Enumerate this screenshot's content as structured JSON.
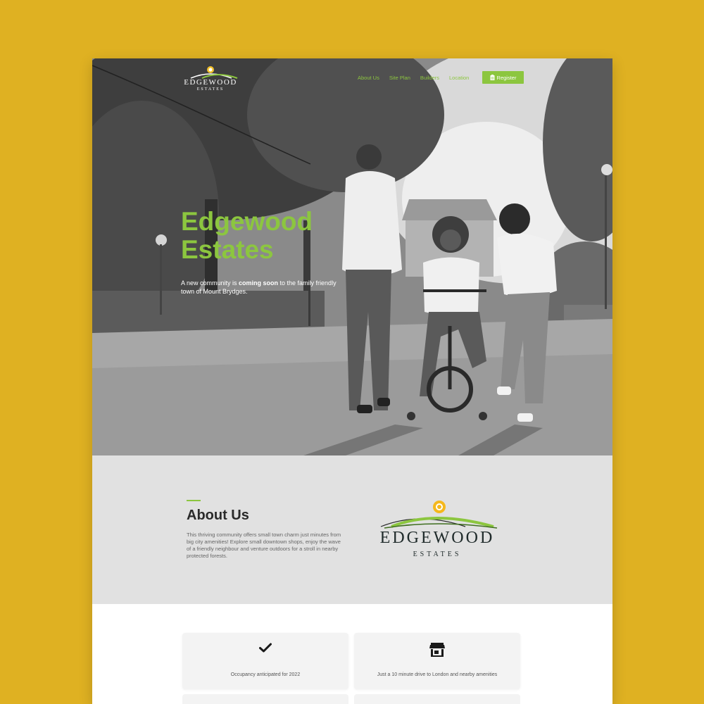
{
  "brand": {
    "name": "EDGEWOOD",
    "sub": "ESTATES"
  },
  "nav": {
    "items": [
      {
        "label": "About Us"
      },
      {
        "label": "Site Plan"
      },
      {
        "label": "Builders"
      },
      {
        "label": "Location"
      }
    ],
    "register_label": "Register"
  },
  "hero": {
    "title_line1": "Edgewood",
    "title_line2": "Estates",
    "sub_before": "A new community is ",
    "sub_bold": "coming soon",
    "sub_after": " to the family friendly town of Mount Brydges."
  },
  "about": {
    "heading": "About Us",
    "body": "This thriving community offers small town charm just minutes from big city amenities! Explore small downtown shops, enjoy the wave of a friendly neighbour and venture outdoors for a stroll in nearby protected forests."
  },
  "features": [
    {
      "icon": "check-icon",
      "text": "Occupancy anticipated for 2022"
    },
    {
      "icon": "store-icon",
      "text": "Just a 10 minute drive to London and nearby amenities"
    }
  ],
  "colors": {
    "background": "#dfb122",
    "accent": "#8cc63f",
    "about_bg": "#e1e1e1",
    "heading": "#2a2a2a"
  }
}
